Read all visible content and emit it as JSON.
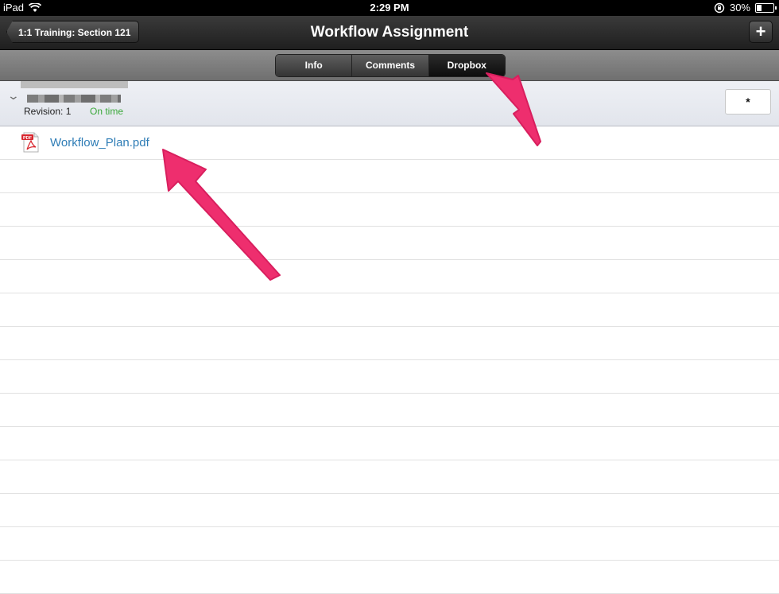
{
  "status_bar": {
    "device": "iPad",
    "time": "2:29 PM",
    "battery": "30%",
    "battery_level": 0.3
  },
  "nav": {
    "back_label": "1:1 Training: Section 121",
    "title": "Workflow Assignment",
    "add_label": "+"
  },
  "segments": [
    {
      "label": "Info",
      "active": false
    },
    {
      "label": "Comments",
      "active": false
    },
    {
      "label": "Dropbox",
      "active": true
    }
  ],
  "submission": {
    "revision": "Revision: 1",
    "status": "On time",
    "status_color": "#3aa83a",
    "action_label": "*"
  },
  "files": [
    {
      "name": "Workflow_Plan.pdf",
      "icon": "pdf-icon",
      "icon_label": "PDF"
    }
  ],
  "empty_rows": 13,
  "colors": {
    "link": "#2f7db6",
    "arrow": "#ee2e6e"
  }
}
